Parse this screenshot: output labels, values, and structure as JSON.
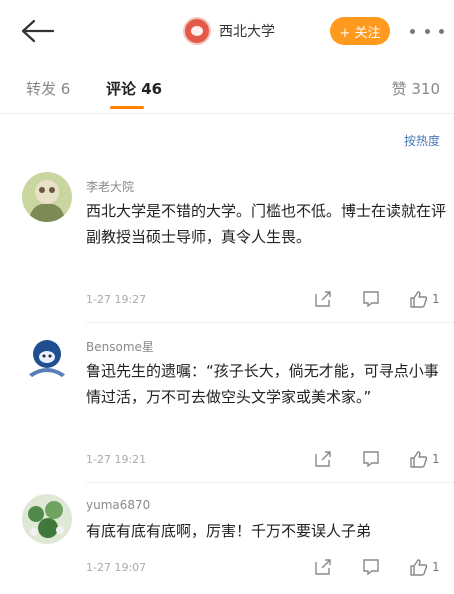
{
  "header": {
    "account_name": "西北大学",
    "follow_label": "+ 关注"
  },
  "tabs": {
    "repost": "转发 6",
    "comments": "评论 46",
    "likes": "赞 310"
  },
  "sort_label": "按热度",
  "comments": [
    {
      "user": "李老大院",
      "text": "西北大学是不错的大学。门槛也不低。博士在读就在评副教授当硕士导师，真令人生畏。",
      "time": "1-27 19:27",
      "likes": "1"
    },
    {
      "user": "Bensome星",
      "text": "鲁迅先生的遗嘱：“孩子长大，倘无才能，可寻点小事情过活，万不可去做空头文学家或美术家。”",
      "time": "1-27 19:21",
      "likes": "1"
    },
    {
      "user": "yuma6870",
      "text": "有底有底有底啊，厉害！千万不要误人子弟",
      "time": "1-27 19:07",
      "likes": "1"
    }
  ],
  "colors": {
    "accent": "#ff8200",
    "follow_bg": "#ff9a1f",
    "link": "#4a78b8"
  },
  "icons": [
    "back-arrow-icon",
    "more-dots-icon",
    "thumbs-up-icon",
    "share-icon",
    "reply-icon"
  ]
}
